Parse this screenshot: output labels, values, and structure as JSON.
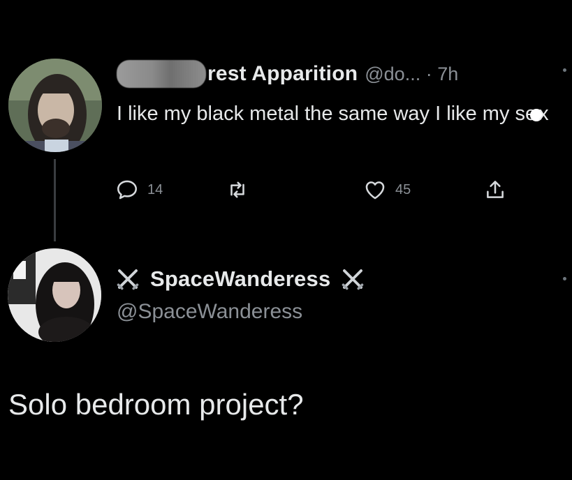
{
  "tweet": {
    "avatar_icon": "profile-photo-man-long-hair",
    "display_name": "rest Apparition",
    "meta": "@do... · 7h",
    "text": "I like my black metal the same way I like my se",
    "text_tail": "x",
    "actions": {
      "reply_icon": "reply-icon",
      "reply_count": "14",
      "retweet_icon": "retweet-icon",
      "like_icon": "heart-icon",
      "like_count": "45",
      "share_icon": "share-icon"
    }
  },
  "reply": {
    "avatar_icon": "profile-photo-woman-dark-hair",
    "display_name": "SpaceWanderess",
    "name_emoji": "crossed-swords-icon",
    "handle": "@SpaceWanderess",
    "text": "Solo bedroom project?"
  },
  "colors": {
    "background": "#000000",
    "primary_text": "#e7e9ea",
    "secondary_text": "#8b9096"
  }
}
